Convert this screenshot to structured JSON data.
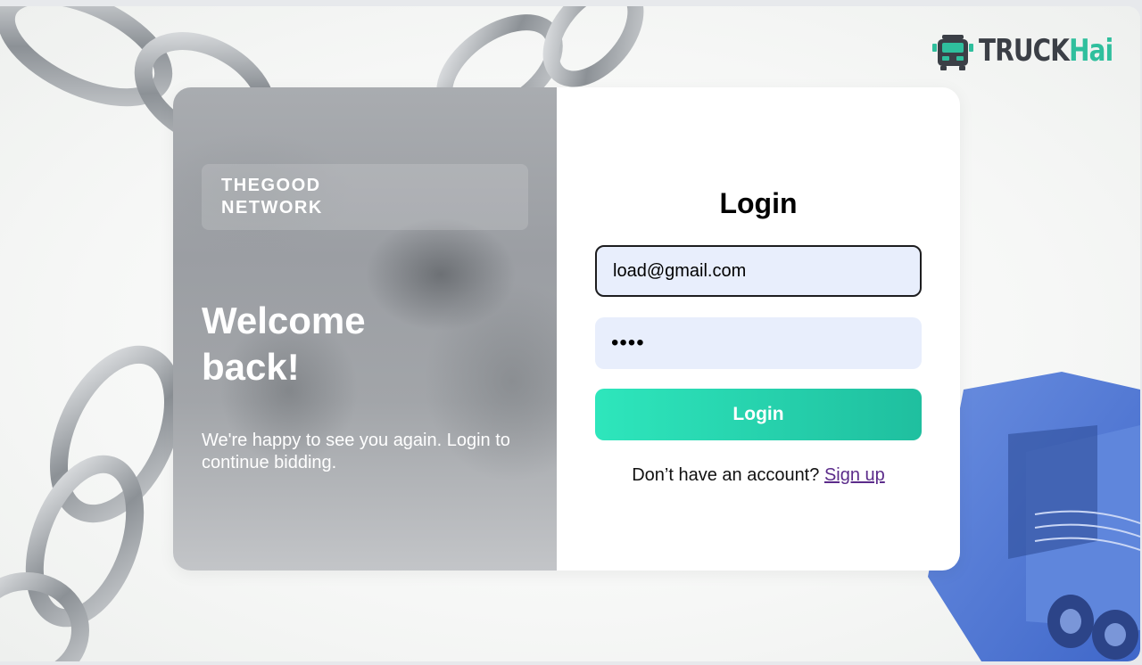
{
  "logo": {
    "brand_part1": "TRUCK",
    "brand_part2": "Hai",
    "colors": {
      "dark": "#3b3f46",
      "accent": "#2fbf9d"
    }
  },
  "left_panel": {
    "network_name": "THEGOOD NETWORK",
    "welcome_heading": "Welcome back!",
    "subtext": "We're happy to see you again. Login to continue bidding."
  },
  "login_form": {
    "title": "Login",
    "email_value": "load@gmail.com",
    "password_masked": "••••",
    "submit_label": "Login",
    "signup_prompt": "Don’t have an account?",
    "signup_link": "Sign up",
    "colors": {
      "button_start": "#2ee6bc",
      "button_end": "#1fbf9f",
      "field_bg": "#e8eefc",
      "link": "#5b2b8a"
    }
  },
  "decorations": [
    "chain-links-background",
    "blue-truck-illustration"
  ]
}
